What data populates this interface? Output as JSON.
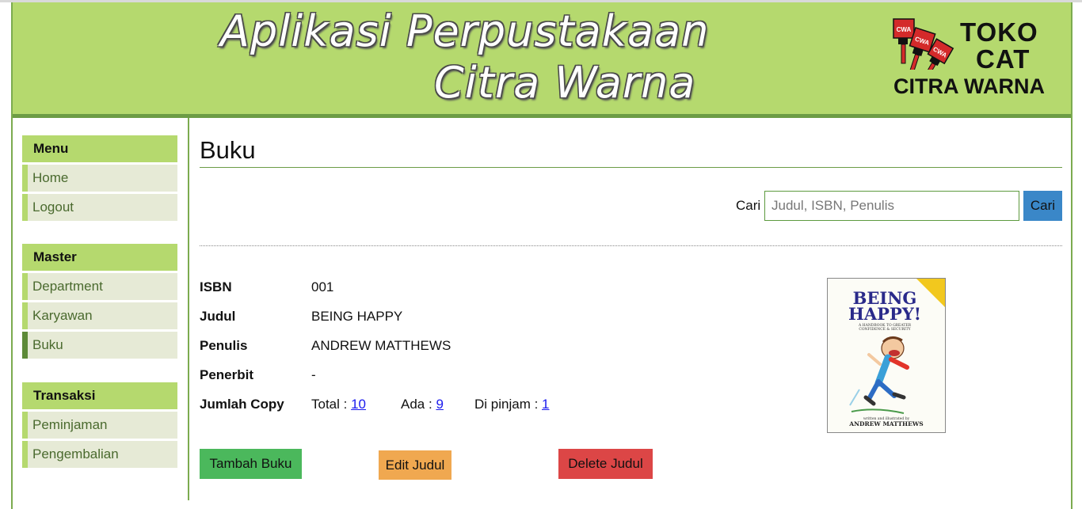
{
  "header": {
    "title_line1": "Aplikasi Perpustakaan",
    "title_line2": "Citra Warna",
    "logo": {
      "line1": "TOKO",
      "line2": "CAT",
      "line3": "CITRA WARNA",
      "brush_label": "CWA"
    }
  },
  "sidebar": {
    "groups": [
      {
        "title": "Menu",
        "items": [
          {
            "label": "Home"
          },
          {
            "label": "Logout"
          }
        ]
      },
      {
        "title": "Master",
        "items": [
          {
            "label": "Department"
          },
          {
            "label": "Karyawan"
          },
          {
            "label": "Buku",
            "active": true
          }
        ]
      },
      {
        "title": "Transaksi",
        "items": [
          {
            "label": "Peminjaman"
          },
          {
            "label": "Pengembalian"
          }
        ]
      }
    ]
  },
  "main": {
    "page_title": "Buku",
    "search": {
      "label": "Cari",
      "placeholder": "Judul, ISBN, Penulis",
      "value": "",
      "button_label": "Cari"
    },
    "book": {
      "fields": [
        {
          "key": "ISBN",
          "value": "001"
        },
        {
          "key": "Judul",
          "value": "BEING HAPPY"
        },
        {
          "key": "Penulis",
          "value": "ANDREW MATTHEWS"
        },
        {
          "key": "Penerbit",
          "value": "-"
        }
      ],
      "copies": {
        "key": "Jumlah Copy",
        "total_label": "Total :",
        "total_value": "10",
        "available_label": "Ada :",
        "available_value": "9",
        "borrowed_label": "Di pinjam :",
        "borrowed_value": "1"
      },
      "cover": {
        "title_line1": "BEING",
        "title_line2": "HAPPY!",
        "subtitle1": "A HANDBOOK TO GREATER",
        "subtitle2": "CONFIDENCE & SECURITY",
        "credit": "written and illustrated by",
        "author": "ANDREW MATTHEWS"
      }
    },
    "buttons": {
      "add": "Tambah Buku",
      "edit": "Edit Judul",
      "delete": "Delete Judul"
    }
  },
  "colors": {
    "header_green": "#b5d96e",
    "dark_green": "#6c9c45",
    "search_button": "#3a87c8",
    "add_button": "#4bb85c",
    "edit_button": "#f0a850",
    "delete_button": "#dc4646",
    "link": "#1a1aee"
  }
}
